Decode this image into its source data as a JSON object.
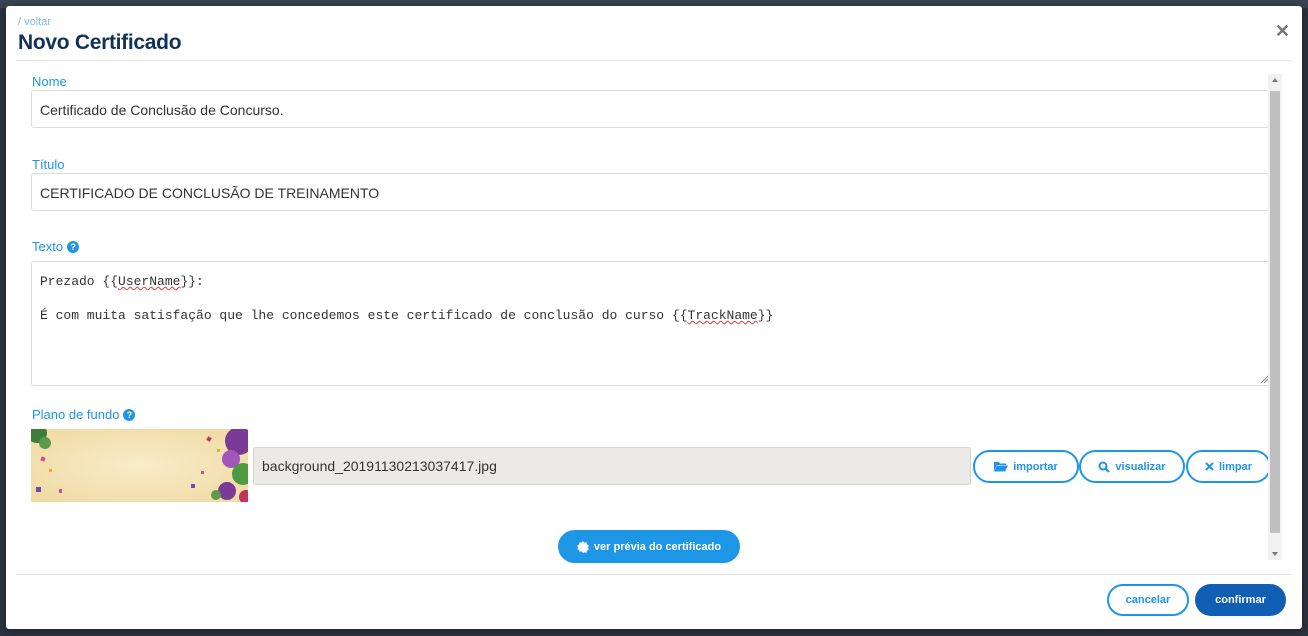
{
  "header": {
    "back_link": "/ voltar",
    "title": "Novo Certificado"
  },
  "form": {
    "nome_label": "Nome",
    "nome_value": "Certificado de Conclusão de Concurso.",
    "titulo_label": "Título",
    "titulo_value": "CERTIFICADO DE CONCLUSÃO DE TREINAMENTO",
    "texto_label": "Texto",
    "texto_line1_prefix": "Prezado {{",
    "texto_line1_var": "UserName",
    "texto_line1_suffix": "}}:",
    "texto_line2_prefix": "É com muita satisfação que lhe concedemos este certificado de conclusão do curso {{",
    "texto_line2_var": "TrackName",
    "texto_line2_suffix": "}}",
    "background_label": "Plano de fundo",
    "background_file": "background_20191130213037417.jpg"
  },
  "buttons": {
    "import": "importar",
    "view": "visualizar",
    "clear": "limpar",
    "preview": "ver prévia do certificado",
    "cancel": "cancelar",
    "confirm": "confirmar"
  },
  "icons": {
    "close": "close-icon",
    "help": "help-icon",
    "folder": "folder-open-icon",
    "search": "search-icon",
    "clear": "x-icon",
    "preview": "certificate-badge-icon"
  },
  "colors": {
    "accent": "#1e96e6",
    "title": "#12325a",
    "confirm": "#0f5fb5"
  }
}
